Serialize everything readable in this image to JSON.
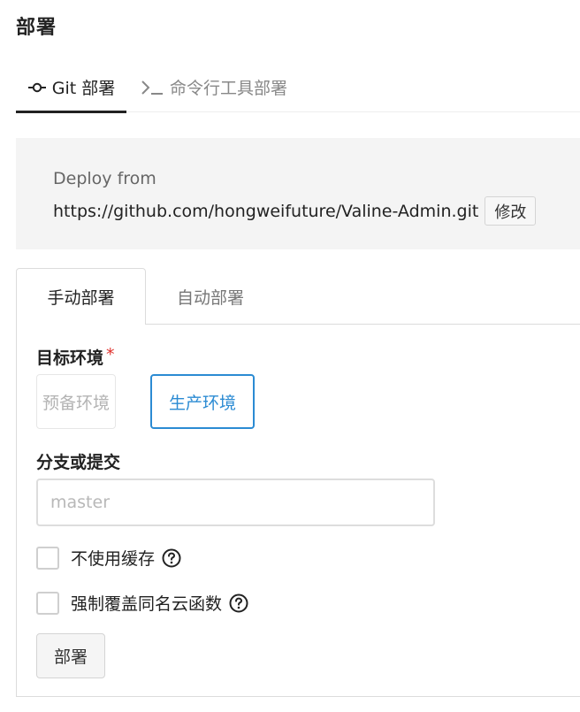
{
  "page": {
    "title": "部署"
  },
  "top_tabs": {
    "git": {
      "label": "Git 部署",
      "icon": "git-commit-icon",
      "active": true
    },
    "cli": {
      "label": "命令行工具部署",
      "icon": "terminal-icon",
      "active": false
    }
  },
  "deploy_from": {
    "label": "Deploy from",
    "url": "https://github.com/hongweifuture/Valine-Admin.git",
    "edit_label": "修改"
  },
  "sub_tabs": {
    "manual": {
      "label": "手动部署",
      "active": true
    },
    "auto": {
      "label": "自动部署",
      "active": false
    }
  },
  "form": {
    "env_label": "目标环境",
    "required_mark": "*",
    "env_options": {
      "staging": "预备环境",
      "production": "生产环境"
    },
    "selected_env": "生产环境",
    "branch_label": "分支或提交",
    "branch_value": "",
    "branch_placeholder": "master",
    "no_cache_label": "不使用缓存",
    "no_cache_checked": false,
    "force_overwrite_label": "强制覆盖同名云函数",
    "force_overwrite_checked": false,
    "help_icon": "question-circle-icon",
    "deploy_label": "部署"
  },
  "colors": {
    "accent": "#2b8bd3",
    "required": "#e0312d",
    "panel_bg": "#f4f4f4",
    "text": "#222222",
    "muted": "#888888"
  }
}
